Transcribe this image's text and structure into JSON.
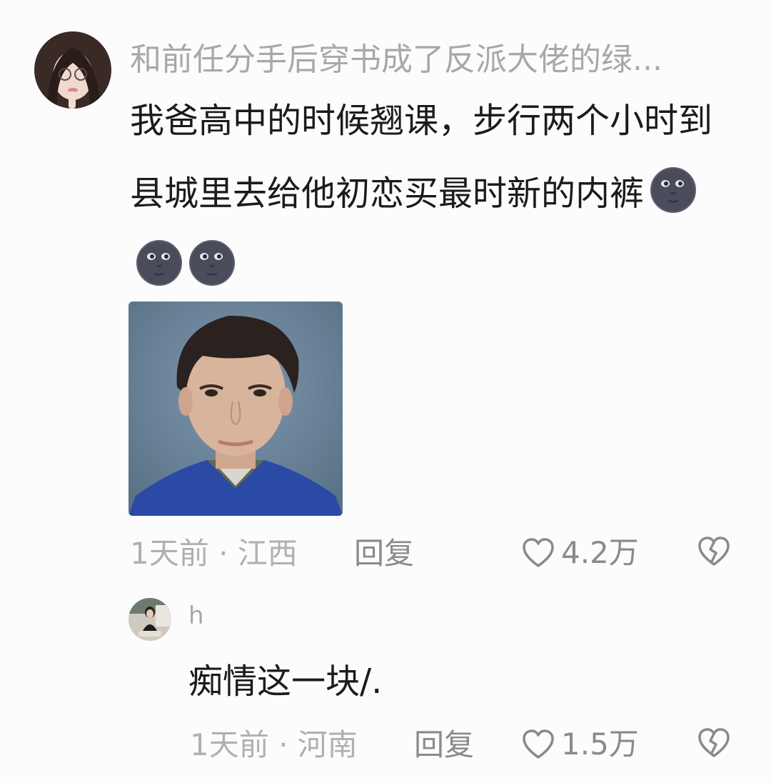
{
  "comment": {
    "username": "和前任分手后穿书成了反派大佬的绿...",
    "text": "我爸高中的时候翘课，步行两个小时到县城里去给他初恋买最时新的内裤",
    "emojis": [
      "new-moon-face-icon",
      "new-moon-face-icon",
      "new-moon-face-icon"
    ],
    "meta": "1天前 · 江西",
    "reply_label": "回复",
    "likes": "4.2万"
  },
  "reply": {
    "username": "h",
    "text": "痴情这一块/.",
    "meta": "1天前 · 河南",
    "reply_label": "回复",
    "likes": "1.5万"
  },
  "colors": {
    "background": "#fcfcfc",
    "text": "#1b1b1b",
    "muted": "#b0b0b0",
    "icon": "#8a8a8a"
  }
}
